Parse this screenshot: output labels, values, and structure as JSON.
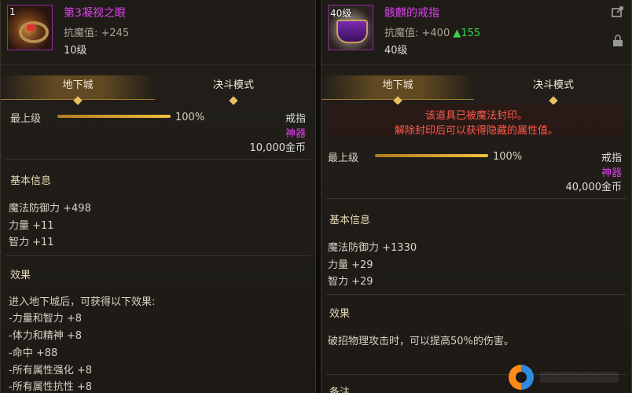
{
  "left": {
    "icon_level": "1",
    "icon_badge": "",
    "name": "第3凝视之眼",
    "stat_line": "抗魔值: +245",
    "level": "10级",
    "tabs": [
      "地下城",
      "决斗模式"
    ],
    "grade_label": "最上级",
    "grade_percent_text": "100%",
    "grade_percent": 1.0,
    "slot": "戒指",
    "rarity": "神器",
    "price": "10,000金币",
    "basic_info_title": "基本信息",
    "basic_stats": [
      "魔法防御力 +498",
      "力量 +11",
      "智力 +11"
    ],
    "effect_title": "效果",
    "effects": [
      "进入地下城后，可获得以下效果:",
      "-力量和智力 +8",
      "-体力和精神 +8",
      "-命中 +88",
      "-所有属性强化 +8",
      "-所有属性抗性 +8"
    ]
  },
  "right": {
    "icon_level": "40级",
    "name": "骸麒的戒指",
    "stat_prefix": "抗魔值: +400 ",
    "stat_up": "▲155",
    "level": "40级",
    "tabs": [
      "地下城",
      "决斗模式"
    ],
    "sealed_line1": "该道具已被魔法封印。",
    "sealed_line2": "解除封印后可以获得隐藏的属性值。",
    "grade_label": "最上级",
    "grade_percent_text": "100%",
    "grade_percent": 1.0,
    "slot": "戒指",
    "rarity": "神器",
    "price": "40,000金币",
    "basic_info_title": "基本信息",
    "basic_stats": [
      "魔法防御力 +1330",
      "力量 +29",
      "智力 +29"
    ],
    "effect_title": "效果",
    "effects": [
      "破招物理攻击时，可以提高50%的伤害。"
    ],
    "next_section_peek": "备注"
  },
  "icons": {
    "share": "share-icon",
    "lock": "lock-icon"
  },
  "colors": {
    "item_name": "#e040f0",
    "stat_up": "#3fd34a",
    "sealed_text": "#ff5a4a",
    "bar": "#f0c040"
  }
}
